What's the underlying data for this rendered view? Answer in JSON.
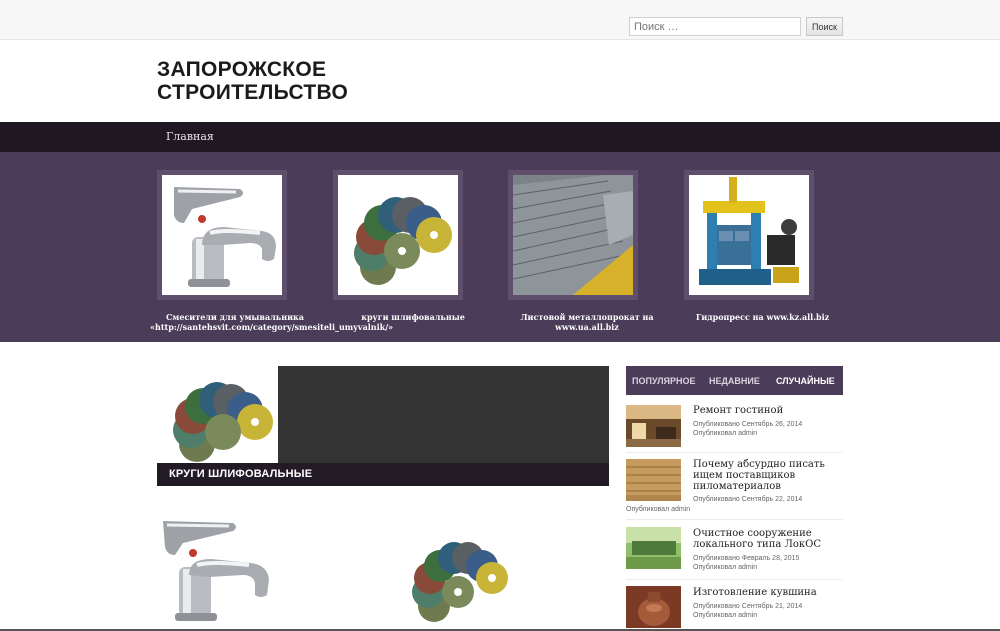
{
  "search": {
    "placeholder": "Поиск …",
    "button_label": "Поиск"
  },
  "site": {
    "title_line1": "ЗАПОРОЖСКОЕ",
    "title_line2": "СТРОИТЕЛЬСТВО"
  },
  "nav": {
    "items": [
      {
        "label": "Главная"
      }
    ]
  },
  "featured": [
    {
      "caption": "Смесители для умывальника «http://santehsvit.com/category/smesiteli_umyvalnik/»",
      "icon": "faucet-image"
    },
    {
      "caption": "круги шлифовальные",
      "icon": "grinding-discs-image"
    },
    {
      "caption": "Листовой металлопрокат на www.ua.all.biz",
      "icon": "sheet-metal-image"
    },
    {
      "caption": "Гидропресс на www.kz.all.biz",
      "icon": "hydraulic-press-image"
    }
  ],
  "main": {
    "feature_title": "КРУГИ ШЛИФОВАЛЬНЫЕ"
  },
  "sidebar": {
    "tabs": [
      {
        "label": "ПОПУЛЯРНОЕ"
      },
      {
        "label": "НЕДАВНИЕ"
      },
      {
        "label": "СЛУЧАЙНЫЕ"
      }
    ],
    "active_tab": "СЛУЧАЙНЫЕ",
    "posts": [
      {
        "title": "Ремонт гостиной",
        "date_line": "Опубликовано Сентябрь 26, 2014",
        "author_line": "Опубликовал admin"
      },
      {
        "title": "Почему абсурдно писать ищем поставщиков пиломатериалов",
        "date_line": "Опубликовано Сентябрь 22, 2014",
        "author_line": "Опубликовал admin"
      },
      {
        "title": "Очистное сооружение локального типа ЛокОС",
        "date_line": "Опубликовано Февраль 28, 2015",
        "author_line": "Опубликовал admin"
      },
      {
        "title": "Изготовление кувшина",
        "date_line": "Опубликовано Сентябрь 21, 2014",
        "author_line": "Опубликовал admin"
      }
    ]
  },
  "colors": {
    "nav_bg": "#1f1722",
    "strip_bg": "#4b3c59",
    "feature_dark": "#333333"
  }
}
